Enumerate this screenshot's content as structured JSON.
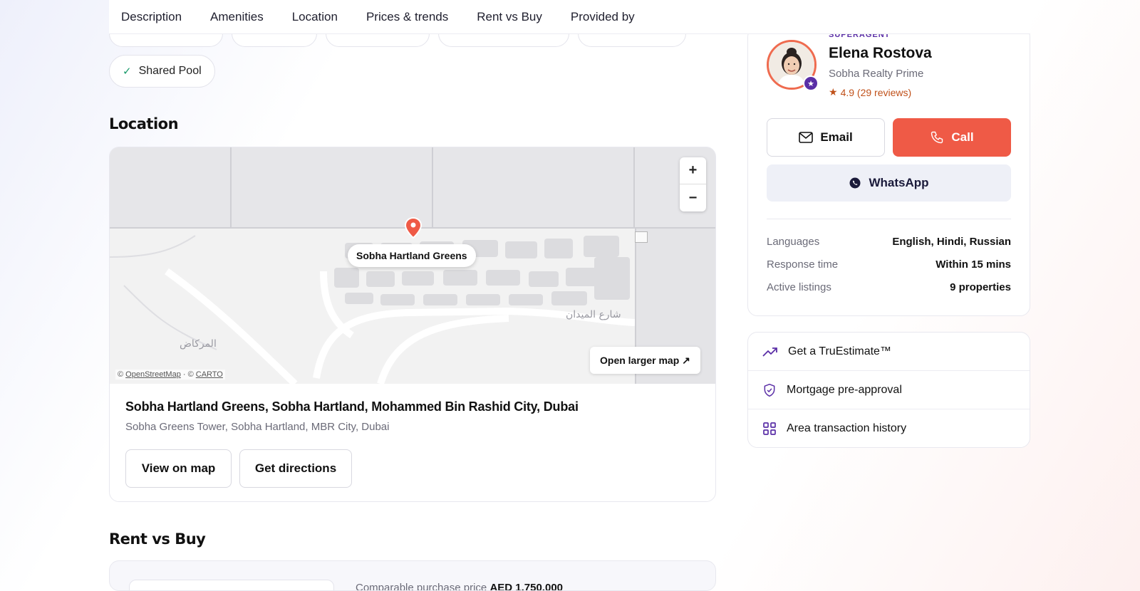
{
  "tabs": [
    "Description",
    "Amenities",
    "Location",
    "Prices & trends",
    "Rent vs Buy",
    "Provided by"
  ],
  "amenities": {
    "last_chip": "Shared Pool"
  },
  "location": {
    "heading": "Location",
    "map_pin_label": "Sobha Hartland Greens",
    "open_larger_map": "Open larger map ↗",
    "zoom_in": "+",
    "zoom_out": "−",
    "attribution_prefix": "© ",
    "attribution_osm": "OpenStreetMap",
    "attribution_sep": " · © ",
    "attribution_carto": "CARTO",
    "street_label_1": "المركاض",
    "street_label_2": "شارع الميدان",
    "address_title": "Sobha Hartland Greens, Sobha Hartland, Mohammed Bin Rashid City, Dubai",
    "address_sub": "Sobha Greens Tower, Sobha Hartland, MBR City, Dubai",
    "view_on_map": "View on map",
    "get_directions": "Get directions"
  },
  "rent_vs_buy": {
    "heading": "Rent vs Buy",
    "comparable_label": "Comparable purchase price",
    "comparable_value": "AED 1,750,000"
  },
  "agent": {
    "badge": "SUPERAGENT",
    "name": "Elena Rostova",
    "company": "Sobha Realty Prime",
    "rating": "4.9 (29 reviews)",
    "email_label": "Email",
    "call_label": "Call",
    "whatsapp_label": "WhatsApp",
    "info": [
      {
        "key": "Languages",
        "value": "English, Hindi, Russian"
      },
      {
        "key": "Response time",
        "value": "Within 15 mins"
      },
      {
        "key": "Active listings",
        "value": "9 properties"
      }
    ]
  },
  "tools": [
    {
      "label": "Get a TruEstimate™",
      "icon": "trending-up-icon"
    },
    {
      "label": "Mortgage pre-approval",
      "icon": "shield-check-icon"
    },
    {
      "label": "Area transaction history",
      "icon": "grid-icon"
    }
  ],
  "colors": {
    "accent": "#ef5a46",
    "brand_purple": "#5a2ea6",
    "rating": "#c0511a"
  }
}
